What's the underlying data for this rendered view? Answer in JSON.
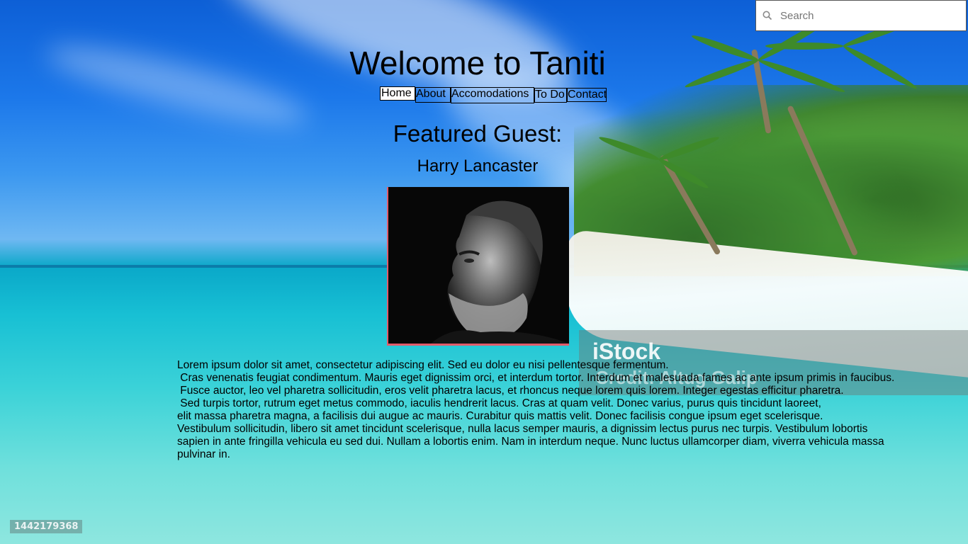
{
  "search": {
    "placeholder": "Search",
    "icon": "search-icon"
  },
  "header": {
    "title": "Welcome to Taniti"
  },
  "nav": {
    "items": [
      {
        "label": "Home",
        "active": true
      },
      {
        "label": "About"
      },
      {
        "label": "Accomodations"
      },
      {
        "label": "To Do"
      },
      {
        "label": "Contact"
      }
    ]
  },
  "featured": {
    "heading": "Featured Guest:",
    "name": "Harry Lancaster",
    "bio_lines": [
      "Lorem ipsum dolor sit amet, consectetur adipiscing elit. Sed eu dolor eu nisi pellentesque fermentum.",
      " Cras venenatis feugiat condimentum. Mauris eget dignissim orci, et interdum tortor. Interdum et malesuada fames ac ante ipsum primis in faucibus.",
      " Fusce auctor, leo vel pharetra sollicitudin, eros velit pharetra lacus, et rhoncus neque lorem quis lorem. Integer egestas efficitur pharetra.",
      " Sed turpis tortor, rutrum eget metus commodo, iaculis hendrerit lacus. Cras at quam velit. Donec varius, purus quis tincidunt laoreet,",
      "elit massa pharetra magna, a facilisis dui augue ac mauris. Curabitur quis mattis velit. Donec facilisis congue ipsum eget scelerisque.",
      "Vestibulum sollicitudin, libero sit amet tincidunt scelerisque, nulla lacus semper mauris, a dignissim lectus purus nec turpis. Vestibulum lobortis",
      "sapien in ante fringilla vehicula eu sed dui. Nullam a lobortis enim. Nam in interdum neque. Nunc luctus ullamcorper diam, viverra vehicula massa",
      "pulvinar in."
    ]
  },
  "watermark": {
    "logo": "iStock",
    "credit": "Credit: Altug Galip",
    "id": "1442179368"
  },
  "colors": {
    "photo_border": "#e25b6a",
    "text": "#000000"
  }
}
